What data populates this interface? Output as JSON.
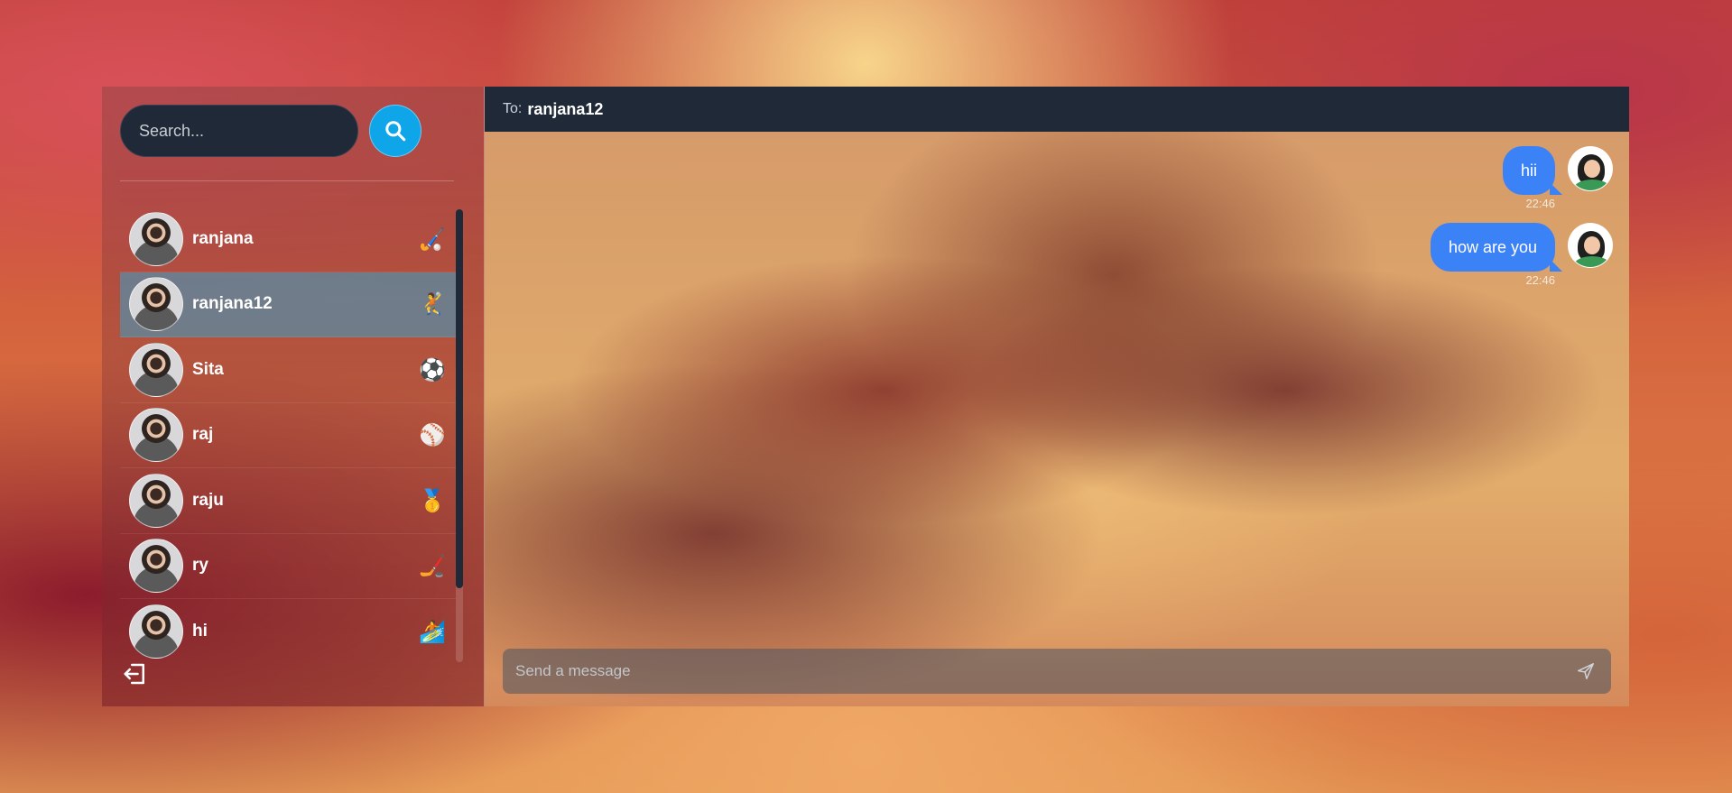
{
  "search": {
    "placeholder": "Search..."
  },
  "conversations": [
    {
      "name": "ranjana",
      "emoji": "🏑",
      "selected": false
    },
    {
      "name": "ranjana12",
      "emoji": "🤾",
      "selected": true
    },
    {
      "name": "Sita",
      "emoji": "⚽",
      "selected": false
    },
    {
      "name": "raj",
      "emoji": "⚾",
      "selected": false
    },
    {
      "name": "raju",
      "emoji": "🥇",
      "selected": false
    },
    {
      "name": "ry",
      "emoji": "🏒",
      "selected": false
    },
    {
      "name": "hi",
      "emoji": "🏄",
      "selected": false
    }
  ],
  "chat": {
    "to_label": "To:",
    "to_name": "ranjana12",
    "messages": [
      {
        "text": "hii",
        "time": "22:46"
      },
      {
        "text": "how are you",
        "time": "22:46"
      }
    ],
    "composer_placeholder": "Send a message"
  },
  "colors": {
    "accent": "#0ea5e9",
    "bubble": "#3b82f6",
    "header_bg": "#1f2937",
    "selected_row": "#38a0c8"
  },
  "icons": {
    "search": "search-icon",
    "logout": "logout-icon",
    "send": "send-icon"
  }
}
